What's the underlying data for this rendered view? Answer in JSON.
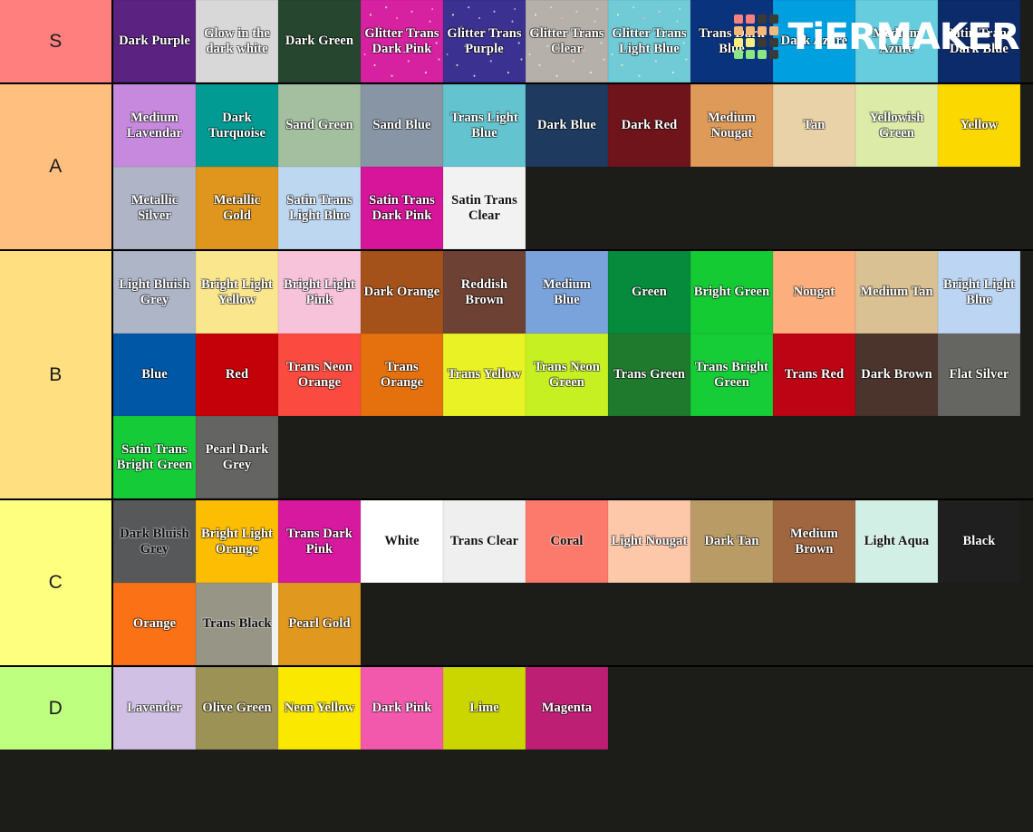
{
  "watermark": {
    "brand": "TiERMAKER",
    "logo_icon": "tiermaker-grid-logo",
    "grid_colors": [
      "#f98080",
      "#f98080",
      "#3a3a36",
      "#3a3a36",
      "#f7b878",
      "#f7b878",
      "#f7b878",
      "#f7b878",
      "#f6ef7e",
      "#f6ef7e",
      "#3a3a36",
      "#3a3a36",
      "#8ae87f",
      "#8ae87f",
      "#8ae87f",
      "#3a3a36"
    ]
  },
  "background_color": "#1c1c18",
  "tiers": [
    {
      "label": "S",
      "label_color": "#FF7F7F",
      "items": [
        {
          "name": "Dark Purple",
          "color": "#5B2282",
          "text": "light"
        },
        {
          "name": "Glow in the dark white",
          "color": "#D8D8D8",
          "text": "light"
        },
        {
          "name": "Dark Green",
          "color": "#27462F",
          "text": "light"
        },
        {
          "name": "Glitter Trans Dark Pink",
          "color": "#D621A0",
          "text": "light",
          "glitter": true
        },
        {
          "name": "Glitter Trans Purple",
          "color": "#3B3190",
          "text": "light",
          "glitter": true
        },
        {
          "name": "Glitter Trans Clear",
          "color": "#B6B0AA",
          "text": "light",
          "glitter": true
        },
        {
          "name": "Glitter Trans Light Blue",
          "color": "#71CBD6",
          "text": "light",
          "glitter": true
        },
        {
          "name": "Trans Dark Blue",
          "color": "#0A337E",
          "text": "light"
        },
        {
          "name": "Dark Azure",
          "color": "#009FDF",
          "text": "light"
        },
        {
          "name": "Medium Azure",
          "color": "#65CDDE",
          "text": "light"
        },
        {
          "name": "Satin Trans Dark Blue",
          "color": "#0B2B6B",
          "text": "light"
        }
      ]
    },
    {
      "label": "A",
      "label_color": "#FFBF7F",
      "items": [
        {
          "name": "Medium Lavendar",
          "color": "#C689DE",
          "text": "light"
        },
        {
          "name": "Dark Turquoise",
          "color": "#029B93",
          "text": "light"
        },
        {
          "name": "Sand Green",
          "color": "#A3BFA0",
          "text": "light"
        },
        {
          "name": "Sand Blue",
          "color": "#8795A4",
          "text": "light"
        },
        {
          "name": "Trans Light Blue",
          "color": "#63C3CE",
          "text": "light"
        },
        {
          "name": "Dark Blue",
          "color": "#1E3A5F",
          "text": "light"
        },
        {
          "name": "Dark Red",
          "color": "#70141B",
          "text": "light"
        },
        {
          "name": "Medium Nougat",
          "color": "#DE9A59",
          "text": "light"
        },
        {
          "name": "Tan",
          "color": "#E9D2A8",
          "text": "light"
        },
        {
          "name": "Yellowish Green",
          "color": "#DCEBA8",
          "text": "light"
        },
        {
          "name": "Yellow",
          "color": "#FBD800",
          "text": "light"
        },
        {
          "name": "Metallic Silver",
          "color": "#AFB5C7",
          "text": "light"
        },
        {
          "name": "Metallic Gold",
          "color": "#E0961C",
          "text": "light"
        },
        {
          "name": "Satin Trans Light Blue",
          "color": "#BDD7F0",
          "text": "light"
        },
        {
          "name": "Satin Trans Dark Pink",
          "color": "#D6159A",
          "text": "light"
        },
        {
          "name": "Satin Trans Clear",
          "color": "#F2F2F2",
          "text": "dark"
        }
      ]
    },
    {
      "label": "B",
      "label_color": "#FFDF80",
      "items": [
        {
          "name": "Light Bluish Grey",
          "color": "#AEB5C7",
          "text": "light"
        },
        {
          "name": "Bright Light Yellow",
          "color": "#FAE78D",
          "text": "light"
        },
        {
          "name": "Bright Light Pink",
          "color": "#F7C3DB",
          "text": "light"
        },
        {
          "name": "Dark Orange",
          "color": "#A5521A",
          "text": "light"
        },
        {
          "name": "Reddish Brown",
          "color": "#6D4134",
          "text": "light"
        },
        {
          "name": "Medium Blue",
          "color": "#7BA3DB",
          "text": "light"
        },
        {
          "name": "Green",
          "color": "#068B3C",
          "text": "light"
        },
        {
          "name": "Bright Green",
          "color": "#15CB33",
          "text": "light"
        },
        {
          "name": "Nougat",
          "color": "#FCAE7C",
          "text": "light"
        },
        {
          "name": "Medium Tan",
          "color": "#D9C193",
          "text": "light"
        },
        {
          "name": "Bright Light Blue",
          "color": "#BBD5F3",
          "text": "light"
        },
        {
          "name": "Blue",
          "color": "#0057A6",
          "text": "light"
        },
        {
          "name": "Red",
          "color": "#C40008",
          "text": "light"
        },
        {
          "name": "Trans Neon Orange",
          "color": "#FB4A3F",
          "text": "light"
        },
        {
          "name": "Trans Orange",
          "color": "#E4700E",
          "text": "light"
        },
        {
          "name": "Trans Yellow",
          "color": "#E9F224",
          "text": "light"
        },
        {
          "name": "Trans Neon Green",
          "color": "#C6F021",
          "text": "light"
        },
        {
          "name": "Trans Green",
          "color": "#1F7A2E",
          "text": "light"
        },
        {
          "name": "Trans Bright Green",
          "color": "#16CC37",
          "text": "light"
        },
        {
          "name": "Trans Red",
          "color": "#BC0414",
          "text": "light"
        },
        {
          "name": "Dark Brown",
          "color": "#4A342C",
          "text": "light"
        },
        {
          "name": "Flat Silver",
          "color": "#656661",
          "text": "light"
        },
        {
          "name": "Satin Trans Bright Green",
          "color": "#15CC38",
          "text": "light"
        },
        {
          "name": "Pearl Dark Grey",
          "color": "#646462",
          "text": "light"
        }
      ]
    },
    {
      "label": "C",
      "label_color": "#FFFF7F",
      "items": [
        {
          "name": "Dark Bluish Grey",
          "color": "#56585A",
          "text": "dark"
        },
        {
          "name": "Bright Light Orange",
          "color": "#FCBD02",
          "text": "light"
        },
        {
          "name": "Trans Dark Pink",
          "color": "#D6199E",
          "text": "light"
        },
        {
          "name": "White",
          "color": "#FFFFFF",
          "text": "dark"
        },
        {
          "name": "Trans Clear",
          "color": "#EFEFEF",
          "text": "dark"
        },
        {
          "name": "Coral",
          "color": "#FB7A6C",
          "text": "dark"
        },
        {
          "name": "Light Nougat",
          "color": "#FDC7AA",
          "text": "light"
        },
        {
          "name": "Dark Tan",
          "color": "#B99B66",
          "text": "light"
        },
        {
          "name": "Medium Brown",
          "color": "#9F6640",
          "text": "light"
        },
        {
          "name": "Light Aqua",
          "color": "#D2EFE5",
          "text": "dark"
        },
        {
          "name": "Black",
          "color": "#1F1F1F",
          "text": "light"
        },
        {
          "name": "Orange",
          "color": "#FA7215",
          "text": "light"
        },
        {
          "name": "Trans Black",
          "color": "#979585",
          "text": "dark",
          "sliver": true
        },
        {
          "name": "Pearl Gold",
          "color": "#E0981F",
          "text": "light"
        }
      ]
    },
    {
      "label": "D",
      "label_color": "#BFFF7F",
      "items": [
        {
          "name": "Lavender",
          "color": "#CFC0E4",
          "text": "light"
        },
        {
          "name": "Olive Green",
          "color": "#9C9256",
          "text": "light"
        },
        {
          "name": "Neon Yellow",
          "color": "#FAE800",
          "text": "light"
        },
        {
          "name": "Dark Pink",
          "color": "#F259AD",
          "text": "light"
        },
        {
          "name": "Lime",
          "color": "#CBD600",
          "text": "light"
        },
        {
          "name": "Magenta",
          "color": "#BD1F74",
          "text": "light"
        }
      ]
    }
  ]
}
